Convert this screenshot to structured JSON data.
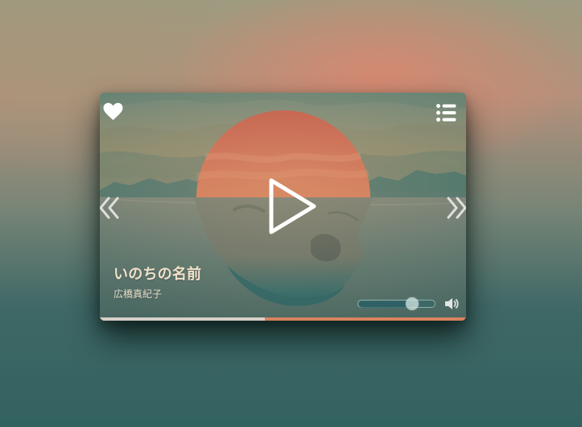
{
  "player": {
    "title": "いのちの名前",
    "artist": "広橋真紀子",
    "favorite_icon": "heart-icon",
    "playlist_icon": "playlist-icon",
    "previous_icon": "previous-icon",
    "next_icon": "next-icon",
    "play_icon": "play-icon",
    "volume_icon": "speaker-icon",
    "progress_percent": 45,
    "volume_percent": 72,
    "colors": {
      "accent": "#d8835f",
      "text": "#f1e0c8",
      "muted_text": "#e7dbc7",
      "progress_played": "#d7d0c9",
      "icon": "#ffffff"
    }
  }
}
